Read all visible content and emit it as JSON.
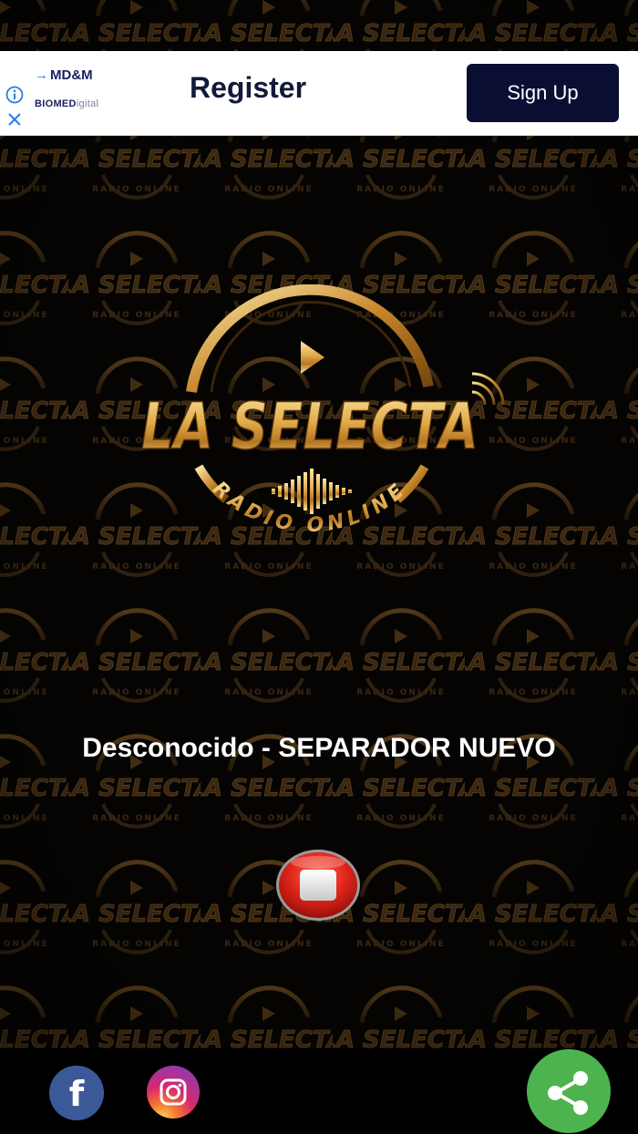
{
  "ad": {
    "brand": "MD&M",
    "sub_brand_bold": "BIOMED",
    "sub_brand_light": "igital",
    "headline": "Register",
    "cta_label": "Sign Up",
    "colors": {
      "cta_bg": "#0a0e33",
      "brand": "#1b1f5e",
      "arrow": "#2a7de1",
      "info": "#2a7de1"
    }
  },
  "logo": {
    "name_text": "LA SELECTA",
    "tagline": "RADIO ONLINE",
    "colors": {
      "gold_light": "#fde7a3",
      "gold": "#d9a43c",
      "gold_dark": "#7a4a0e"
    }
  },
  "player": {
    "now_playing": "Desconocido - SEPARADOR NUEVO",
    "state_icon": "stop-icon",
    "colors": {
      "stop": "#d81b12"
    }
  },
  "social": {
    "facebook_glyph": "f",
    "colors": {
      "facebook": "#3b5998",
      "share": "#4db34f"
    }
  }
}
